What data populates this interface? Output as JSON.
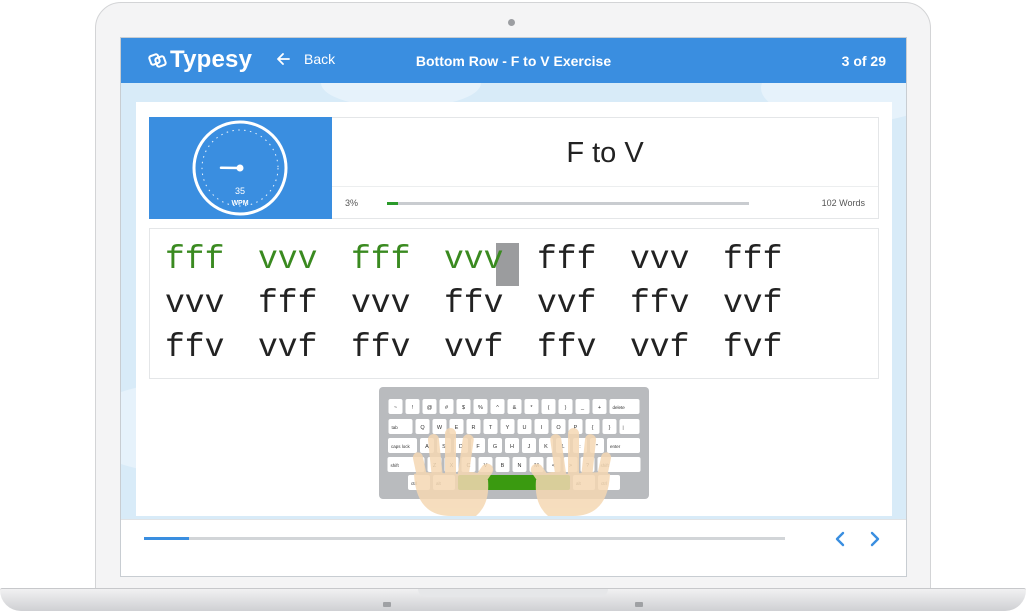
{
  "app": {
    "brand": "Typesy",
    "back_label": "Back",
    "exercise_title": "Bottom Row - F to V Exercise",
    "page_counter": "3 of 29"
  },
  "lesson": {
    "title": "F to V",
    "speed_value": "35",
    "speed_unit": "WPM",
    "speed_needle_fraction": 0.35,
    "progress_label": "3%",
    "progress_fraction": 0.03,
    "word_count_label": "102 Words"
  },
  "typing_text": {
    "lines": [
      [
        "fff",
        "vvv",
        "fff",
        "vvv",
        "fff",
        "vvv",
        "fff"
      ],
      [
        "vvv",
        "fff",
        "vvv",
        "ffv",
        "vvf",
        "ffv",
        "vvf"
      ],
      [
        "ffv",
        "vvf",
        "ffv",
        "vvf",
        "ffv",
        "vvf",
        "fvf"
      ]
    ],
    "completed_words": 4
  },
  "keyboard": {
    "keys": {
      "row0": [
        "~",
        "!",
        "@",
        "#",
        "$",
        "%",
        "^",
        "&",
        "*",
        "(",
        ")",
        "_",
        "+",
        "delete"
      ],
      "row1": [
        "tab",
        "Q",
        "W",
        "E",
        "R",
        "T",
        "Y",
        "U",
        "I",
        "O",
        "P",
        "{",
        "}",
        "|"
      ],
      "row2": [
        "caps lock",
        "A",
        "S",
        "D",
        "F",
        "G",
        "H",
        "J",
        "K",
        "L",
        ":",
        "\"",
        "enter"
      ],
      "row3": [
        "shift",
        "Z",
        "X",
        "C",
        "V",
        "B",
        "N",
        "M",
        "<",
        ">",
        "?",
        "shift"
      ],
      "row4": [
        "ctrl",
        "alt",
        "",
        "alt",
        "ctrl"
      ]
    }
  },
  "footer": {
    "progress_fraction": 0.07,
    "prev_icon": "chevron-left-icon",
    "next_icon": "chevron-right-icon"
  },
  "colors": {
    "brand_blue": "#3a8ee0",
    "correct_green": "#3a8a20",
    "progress_green": "#2a9a2a"
  }
}
